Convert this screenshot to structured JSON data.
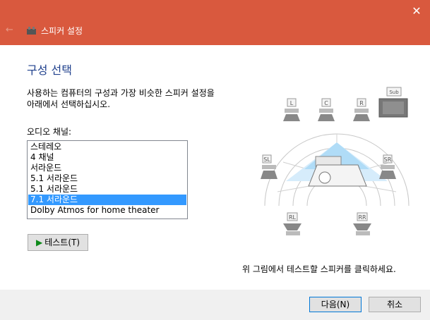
{
  "window": {
    "title": "스피커 설정",
    "close_symbol": "✕",
    "back_symbol": "←"
  },
  "heading": "구성 선택",
  "description_line1": "사용하는 컴퓨터의 구성과 가장 비슷한 스피커 설정을",
  "description_line2": "아래에서 선택하십시오.",
  "channels_label": "오디오 채널:",
  "channels": [
    {
      "label": "스테레오",
      "selected": false
    },
    {
      "label": "4 채널",
      "selected": false
    },
    {
      "label": "서라운드",
      "selected": false
    },
    {
      "label": "5.1 서라운드",
      "selected": false
    },
    {
      "label": "5.1 서라운드",
      "selected": false
    },
    {
      "label": "7.1 서라운드",
      "selected": true
    },
    {
      "label": "Dolby Atmos for home theater",
      "selected": false
    }
  ],
  "test_button": {
    "label": "테스트(T)",
    "icon": "play-icon"
  },
  "speakers": {
    "front_left": "L",
    "center": "C",
    "front_right": "R",
    "subwoofer": "Sub",
    "side_left": "SL",
    "side_right": "SR",
    "rear_left": "RL",
    "rear_right": "RR"
  },
  "hint": "위 그림에서 테스트할 스피커를 클릭하세요.",
  "footer": {
    "next": "다음(N)",
    "cancel": "취소"
  },
  "colors": {
    "titlebar": "#d9593e",
    "heading": "#1e3f8c",
    "selection": "#3399ff",
    "play": "#0d8a1a"
  }
}
